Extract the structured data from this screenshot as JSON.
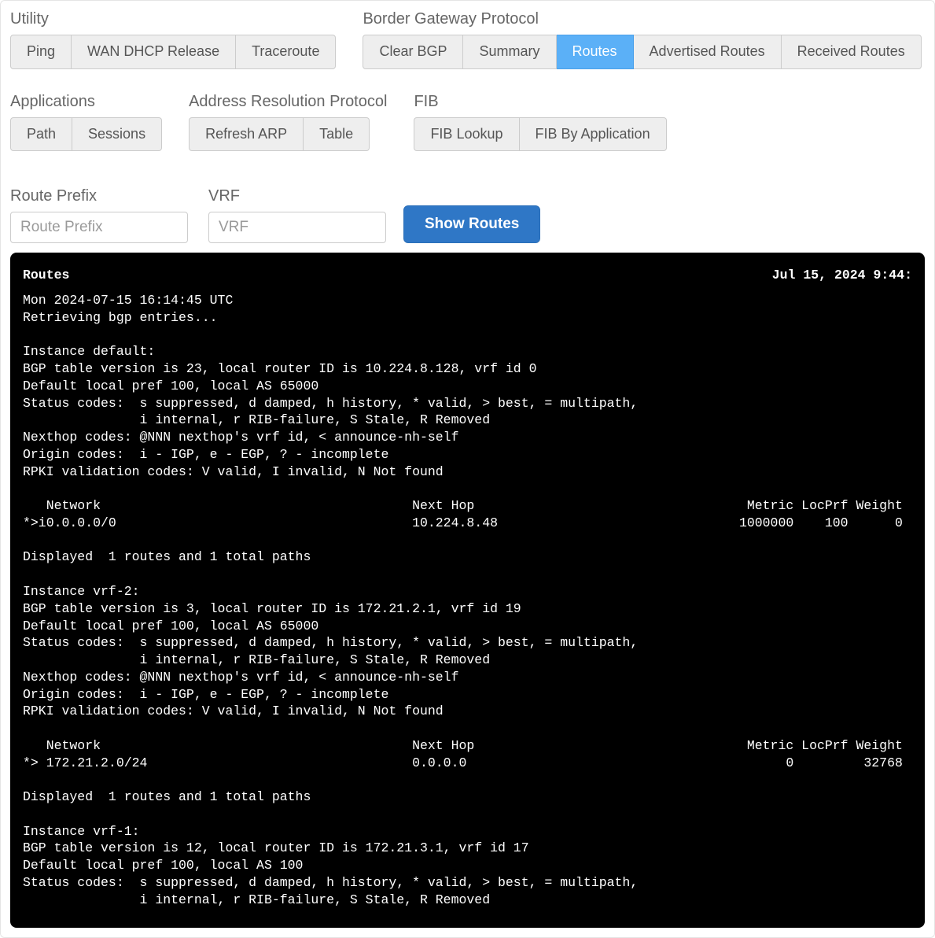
{
  "groups": {
    "utility": {
      "label": "Utility",
      "buttons": [
        "Ping",
        "WAN DHCP Release",
        "Traceroute"
      ]
    },
    "bgp": {
      "label": "Border Gateway Protocol",
      "buttons": [
        "Clear BGP",
        "Summary",
        "Routes",
        "Advertised Routes",
        "Received Routes"
      ],
      "activeIndex": 2
    },
    "apps": {
      "label": "Applications",
      "buttons": [
        "Path",
        "Sessions"
      ]
    },
    "arp": {
      "label": "Address Resolution Protocol",
      "buttons": [
        "Refresh ARP",
        "Table"
      ]
    },
    "fib": {
      "label": "FIB",
      "buttons": [
        "FIB Lookup",
        "FIB By Application"
      ]
    }
  },
  "form": {
    "route_prefix_label": "Route Prefix",
    "route_prefix_placeholder": "Route Prefix",
    "vrf_label": "VRF",
    "vrf_placeholder": "VRF",
    "submit_label": "Show Routes"
  },
  "terminal": {
    "title": "Routes",
    "timestamp": "Jul 15, 2024 9:44:",
    "body": "Mon 2024-07-15 16:14:45 UTC\nRetrieving bgp entries...\n\nInstance default:\nBGP table version is 23, local router ID is 10.224.8.128, vrf id 0\nDefault local pref 100, local AS 65000\nStatus codes:  s suppressed, d damped, h history, * valid, > best, = multipath,\n               i internal, r RIB-failure, S Stale, R Removed\nNexthop codes: @NNN nexthop's vrf id, < announce-nh-self\nOrigin codes:  i - IGP, e - EGP, ? - incomplete\nRPKI validation codes: V valid, I invalid, N Not found\n\n   Network                                        Next Hop                                   Metric LocPrf Weight\n*>i0.0.0.0/0                                      10.224.8.48                               1000000    100      0\n\nDisplayed  1 routes and 1 total paths\n\nInstance vrf-2:\nBGP table version is 3, local router ID is 172.21.2.1, vrf id 19\nDefault local pref 100, local AS 65000\nStatus codes:  s suppressed, d damped, h history, * valid, > best, = multipath,\n               i internal, r RIB-failure, S Stale, R Removed\nNexthop codes: @NNN nexthop's vrf id, < announce-nh-self\nOrigin codes:  i - IGP, e - EGP, ? - incomplete\nRPKI validation codes: V valid, I invalid, N Not found\n\n   Network                                        Next Hop                                   Metric LocPrf Weight\n*> 172.21.2.0/24                                  0.0.0.0                                         0         32768\n\nDisplayed  1 routes and 1 total paths\n\nInstance vrf-1:\nBGP table version is 12, local router ID is 172.21.3.1, vrf id 17\nDefault local pref 100, local AS 100\nStatus codes:  s suppressed, d damped, h history, * valid, > best, = multipath,\n               i internal, r RIB-failure, S Stale, R Removed"
  }
}
